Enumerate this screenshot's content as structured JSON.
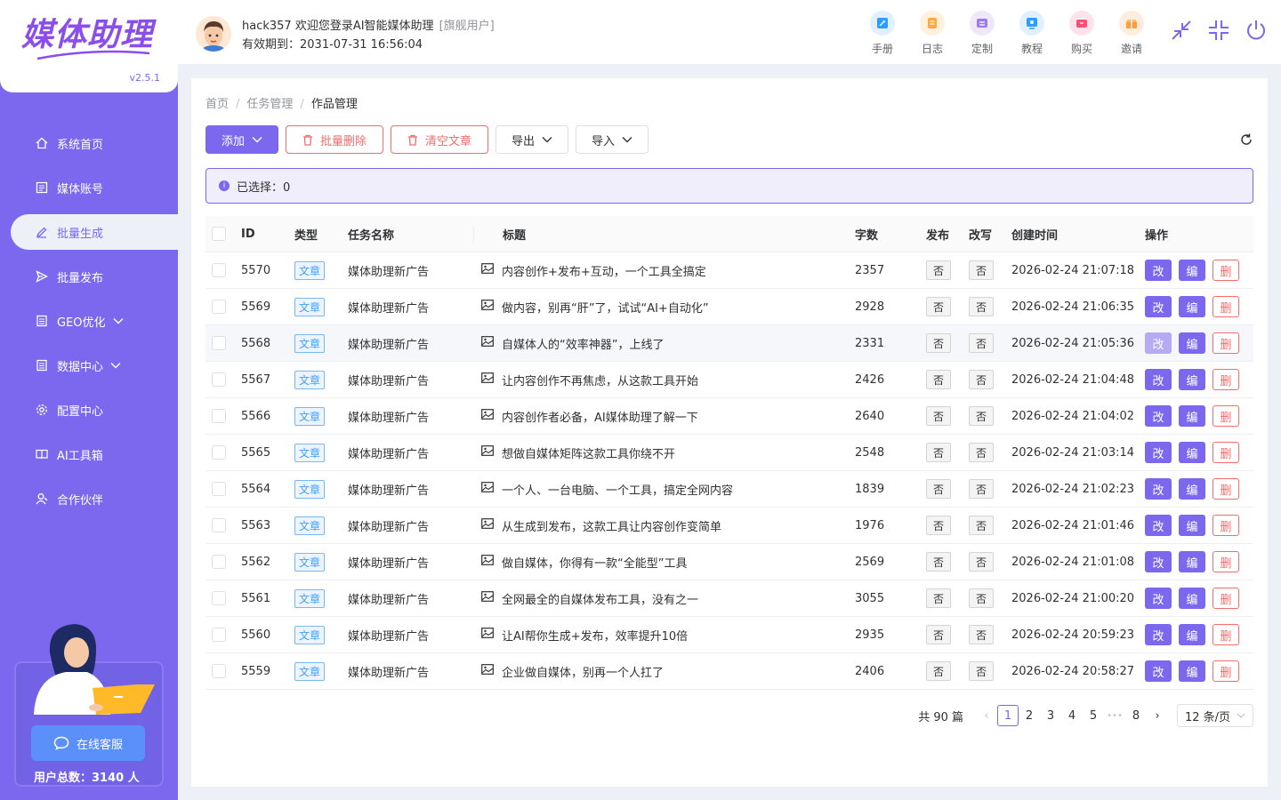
{
  "app": {
    "logo": "媒体助理",
    "version": "v2.5.1"
  },
  "sidebar": {
    "items": [
      {
        "label": "系统首页",
        "icon": "home-icon"
      },
      {
        "label": "媒体账号",
        "icon": "account-icon"
      },
      {
        "label": "批量生成",
        "icon": "edit-icon"
      },
      {
        "label": "批量发布",
        "icon": "send-icon"
      },
      {
        "label": "GEO优化",
        "icon": "doc-icon"
      },
      {
        "label": "数据中心",
        "icon": "data-icon"
      },
      {
        "label": "配置中心",
        "icon": "gear-icon"
      },
      {
        "label": "AI工具箱",
        "icon": "book-icon"
      },
      {
        "label": "合作伙伴",
        "icon": "partner-icon"
      }
    ],
    "service_label": "在线客服",
    "user_total": "用户总数：3140 人"
  },
  "header": {
    "username": "hack357 欢迎您登录AI智能媒体助理",
    "user_tag": "[旗舰用户]",
    "expire": "有效期到：2031-07-31 16:56:04",
    "tools": [
      {
        "label": "手册",
        "icon": "manual-icon",
        "color": "#2d9cff"
      },
      {
        "label": "日志",
        "icon": "log-icon",
        "color": "#ffa940"
      },
      {
        "label": "定制",
        "icon": "custom-icon",
        "color": "#9b7be8"
      },
      {
        "label": "教程",
        "icon": "tutorial-icon",
        "color": "#2d9cff"
      },
      {
        "label": "购买",
        "icon": "buy-icon",
        "color": "#ff4d7a"
      },
      {
        "label": "邀请",
        "icon": "invite-icon",
        "color": "#ff9c3a"
      }
    ]
  },
  "breadcrumb": [
    "首页",
    "任务管理",
    "作品管理"
  ],
  "toolbar": {
    "add": "添加",
    "batch_delete": "批量删除",
    "clear": "清空文章",
    "export": "导出",
    "import": "导入"
  },
  "alert": {
    "selected": "已选择：0"
  },
  "table": {
    "headers": {
      "id": "ID",
      "type": "类型",
      "task": "任务名称",
      "title": "标题",
      "words": "字数",
      "publish": "发布",
      "rewrite": "改写",
      "created": "创建时间",
      "ops": "操作"
    },
    "op_labels": {
      "modify": "改",
      "edit": "编",
      "delete": "删"
    },
    "rows": [
      {
        "id": "5570",
        "type": "文章",
        "task": "媒体助理新广告",
        "title": "内容创作+发布+互动，一个工具全搞定",
        "words": "2357",
        "publish": "否",
        "rewrite": "否",
        "created": "2026-02-24 21:07:18"
      },
      {
        "id": "5569",
        "type": "文章",
        "task": "媒体助理新广告",
        "title": "做内容，别再“肝”了，试试“AI+自动化”",
        "words": "2928",
        "publish": "否",
        "rewrite": "否",
        "created": "2026-02-24 21:06:35"
      },
      {
        "id": "5568",
        "type": "文章",
        "task": "媒体助理新广告",
        "title": "自媒体人的“效率神器”，上线了",
        "words": "2331",
        "publish": "否",
        "rewrite": "否",
        "created": "2026-02-24 21:05:36"
      },
      {
        "id": "5567",
        "type": "文章",
        "task": "媒体助理新广告",
        "title": "让内容创作不再焦虑，从这款工具开始",
        "words": "2426",
        "publish": "否",
        "rewrite": "否",
        "created": "2026-02-24 21:04:48"
      },
      {
        "id": "5566",
        "type": "文章",
        "task": "媒体助理新广告",
        "title": "内容创作者必备，AI媒体助理了解一下",
        "words": "2640",
        "publish": "否",
        "rewrite": "否",
        "created": "2026-02-24 21:04:02"
      },
      {
        "id": "5565",
        "type": "文章",
        "task": "媒体助理新广告",
        "title": "想做自媒体矩阵这款工具你绕不开",
        "words": "2548",
        "publish": "否",
        "rewrite": "否",
        "created": "2026-02-24 21:03:14"
      },
      {
        "id": "5564",
        "type": "文章",
        "task": "媒体助理新广告",
        "title": "一个人、一台电脑、一个工具，搞定全网内容",
        "words": "1839",
        "publish": "否",
        "rewrite": "否",
        "created": "2026-02-24 21:02:23"
      },
      {
        "id": "5563",
        "type": "文章",
        "task": "媒体助理新广告",
        "title": "从生成到发布，这款工具让内容创作变简单",
        "words": "1976",
        "publish": "否",
        "rewrite": "否",
        "created": "2026-02-24 21:01:46"
      },
      {
        "id": "5562",
        "type": "文章",
        "task": "媒体助理新广告",
        "title": "做自媒体，你得有一款“全能型”工具",
        "words": "2569",
        "publish": "否",
        "rewrite": "否",
        "created": "2026-02-24 21:01:08"
      },
      {
        "id": "5561",
        "type": "文章",
        "task": "媒体助理新广告",
        "title": "全网最全的自媒体发布工具，没有之一",
        "words": "3055",
        "publish": "否",
        "rewrite": "否",
        "created": "2026-02-24 21:00:20"
      },
      {
        "id": "5560",
        "type": "文章",
        "task": "媒体助理新广告",
        "title": "让AI帮你生成+发布，效率提升10倍",
        "words": "2935",
        "publish": "否",
        "rewrite": "否",
        "created": "2026-02-24 20:59:23"
      },
      {
        "id": "5559",
        "type": "文章",
        "task": "媒体助理新广告",
        "title": "企业做自媒体，别再一个人扛了",
        "words": "2406",
        "publish": "否",
        "rewrite": "否",
        "created": "2026-02-24 20:58:27"
      }
    ]
  },
  "pagination": {
    "total": "共 90 篇",
    "pages": [
      "1",
      "2",
      "3",
      "4",
      "5",
      "•••",
      "8"
    ],
    "current": "1",
    "page_size": "12 条/页"
  },
  "colors": {
    "primary": "#7b68ee",
    "danger": "#f56c6c",
    "info": "#409eff"
  }
}
